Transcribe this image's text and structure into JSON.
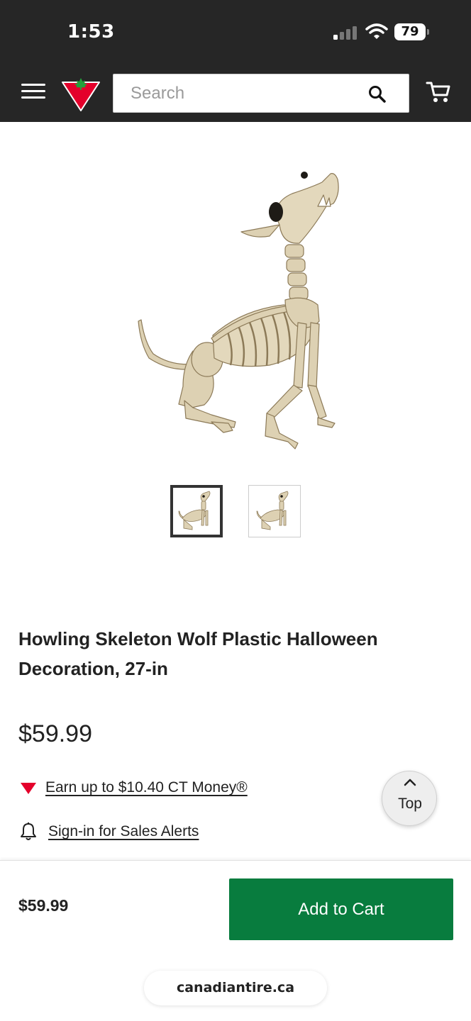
{
  "status_bar": {
    "time": "1:53",
    "battery": "79"
  },
  "header": {
    "search_placeholder": "Search",
    "icons": [
      "hamburger-menu-icon",
      "canadian-tire-logo",
      "search-icon",
      "cart-icon"
    ]
  },
  "product": {
    "title": "Howling Skeleton Wolf Plastic Halloween Decoration, 27-in",
    "price": "$59.99",
    "ct_money": "Earn up to $10.40 CT Money®",
    "sales_alert": "Sign-in for Sales Alerts",
    "thumbnails": [
      {
        "selected": true
      },
      {
        "selected": false
      }
    ]
  },
  "top_button": {
    "label": "Top"
  },
  "footer": {
    "price": "$59.99",
    "add_to_cart": "Add to Cart",
    "url": "canadiantire.ca"
  },
  "colors": {
    "header_bg": "#262626",
    "brand_red": "#e4002b",
    "add_to_cart_green": "#087c3e",
    "bone": "#ddd1b3"
  }
}
